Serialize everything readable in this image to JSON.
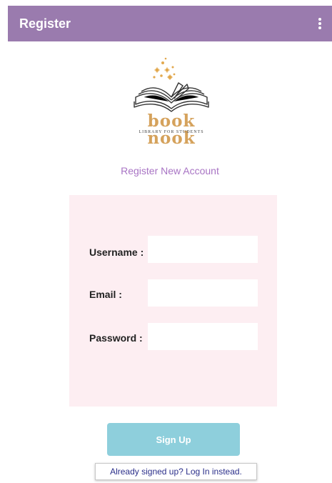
{
  "app_bar": {
    "title": "Register",
    "menu_icon": "overflow-menu-icon"
  },
  "logo": {
    "brand": "book nook",
    "tagline": "LIBRARY FOR STUDENTS"
  },
  "heading": "Register New Account",
  "form": {
    "username_label": "Username :",
    "username_value": "",
    "email_label": "Email :",
    "email_value": "",
    "password_label": "Password :",
    "password_value": ""
  },
  "signup_label": "Sign Up",
  "login_link": "Already signed up? Log In instead.",
  "colors": {
    "app_bar": "#9a7bae",
    "heading": "#a874c4",
    "card": "#fdeef2",
    "button": "#8ecfdc",
    "brand": "#d5a25c",
    "link": "#2b2f8a"
  }
}
